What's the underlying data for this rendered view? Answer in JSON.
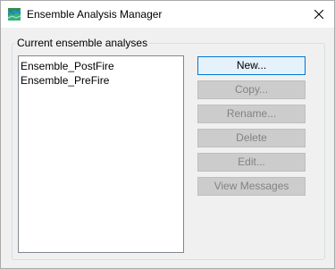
{
  "window": {
    "title": "Ensemble Analysis Manager"
  },
  "icons": {
    "app": "app-logo-icon",
    "close": "close-icon"
  },
  "group": {
    "label": "Current ensemble analyses"
  },
  "list": {
    "items": [
      "Ensemble_PostFire",
      "Ensemble_PreFire"
    ]
  },
  "buttons": {
    "new": "New...",
    "copy": "Copy...",
    "rename": "Rename...",
    "delete": "Delete",
    "edit": "Edit...",
    "view_messages": "View Messages"
  },
  "button_states": {
    "new": "enabled",
    "copy": "disabled",
    "rename": "disabled",
    "delete": "disabled",
    "edit": "disabled",
    "view_messages": "disabled"
  },
  "colors": {
    "accent": "#0078d7",
    "window_bg": "#f0f0f0",
    "disabled_button_bg": "#cccccc",
    "disabled_text": "#838383"
  }
}
